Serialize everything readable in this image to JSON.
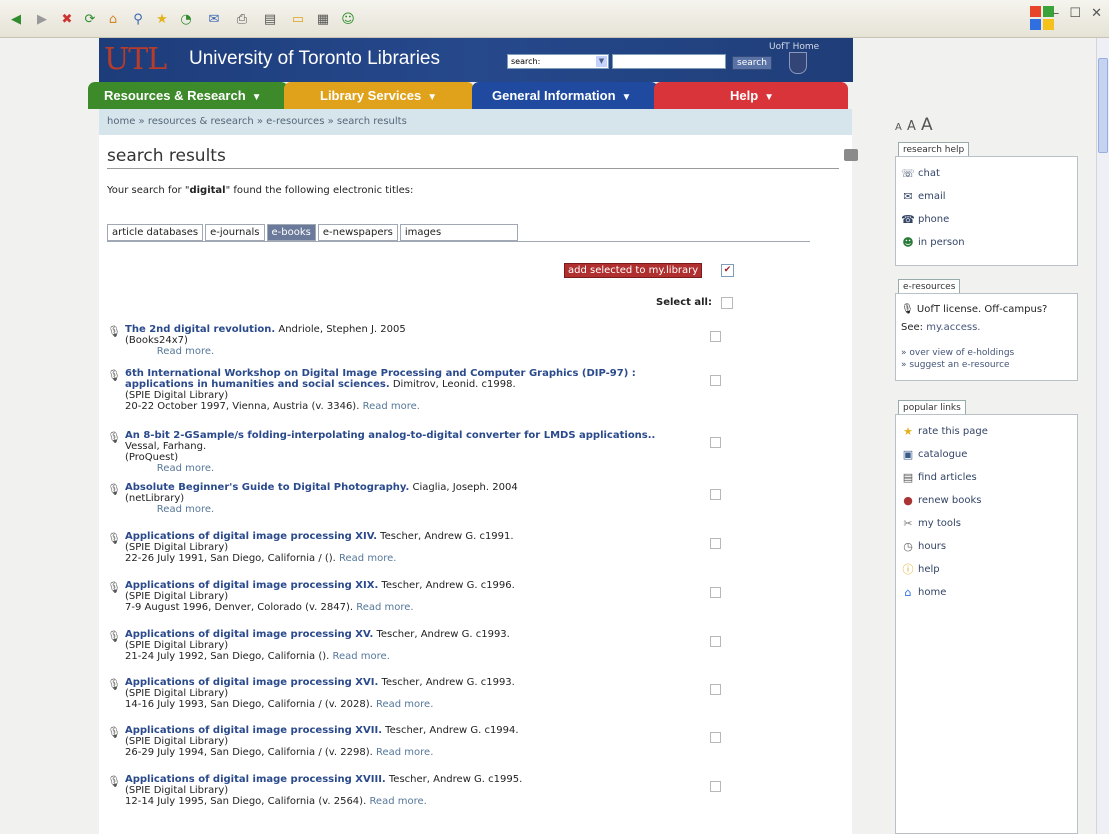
{
  "toolbar": {
    "icons": [
      "back-icon",
      "forward-icon",
      "stop-icon",
      "refresh-icon",
      "home-icon",
      "search-icon",
      "favorites-icon",
      "history-icon",
      "mail-icon",
      "print-icon",
      "edit-icon",
      "discuss-icon",
      "research-icon",
      "messenger-icon"
    ],
    "window_controls": "– ☐ ✕"
  },
  "header": {
    "logo_text": "UTL",
    "title": "University of Toronto Libraries",
    "search_label": "search:",
    "search_button": "search",
    "uoft_home": "UofT Home"
  },
  "nav": {
    "tabs": [
      {
        "label": "Resources & Research",
        "color": "#3d8a2a"
      },
      {
        "label": "Library Services",
        "color": "#e0a21a"
      },
      {
        "label": "General Information",
        "color": "#1f4aa0"
      },
      {
        "label": "Help",
        "color": "#d9343a"
      }
    ]
  },
  "breadcrumb": "home » resources & research » e-resources » search results",
  "page_title": "search results",
  "found": {
    "prefix": "Your search for \"",
    "term": "digital",
    "suffix": "\" found the following electronic titles:"
  },
  "tabs": [
    "article databases",
    "e-journals",
    "e-books",
    "e-newspapers",
    "images"
  ],
  "active_tab": "e-books",
  "add_selected": "add selected to my.library",
  "select_all": "Select all:",
  "read_more": "Read more.",
  "results": [
    {
      "title": "The 2nd digital revolution.",
      "author": " Andriole, Stephen J.    2005",
      "source": "(Books24x7)",
      "extra": ""
    },
    {
      "title": "6th International Workshop on Digital Image Processing and Computer Graphics (DIP-97) : applications in humanities and social sciences.",
      "author": " Dimitrov, Leonid.    c1998.",
      "source": "(SPIE Digital Library)",
      "extra": "20-22 October 1997, Vienna, Austria (v. 3346).   "
    },
    {
      "title": "An 8-bit 2-GSample/s folding-interpolating analog-to-digital converter for LMDS applications..",
      "author": " Vessal, Farhang.",
      "source": "(ProQuest)",
      "extra": ""
    },
    {
      "title": "Absolute Beginner's Guide to Digital Photography.",
      "author": " Ciaglia, Joseph.    2004",
      "source": "(netLibrary)",
      "extra": ""
    },
    {
      "title": "Applications of digital image processing XIV.",
      "author": " Tescher, Andrew G.    c1991.",
      "source": "(SPIE Digital Library)",
      "extra": "22-26 July 1991, San Diego, California / ().   "
    },
    {
      "title": "Applications of digital image processing XIX.",
      "author": " Tescher, Andrew G.    c1996.",
      "source": "(SPIE Digital Library)",
      "extra": "7-9 August 1996, Denver, Colorado (v. 2847).   "
    },
    {
      "title": "Applications of digital image processing XV.",
      "author": " Tescher, Andrew G.    c1993.",
      "source": "(SPIE Digital Library)",
      "extra": "21-24 July 1992, San Diego, California ().   "
    },
    {
      "title": "Applications of digital image processing XVI.",
      "author": " Tescher, Andrew G.    c1993.",
      "source": "(SPIE Digital Library)",
      "extra": "14-16 July 1993, San Diego, California / (v. 2028).   "
    },
    {
      "title": "Applications of digital image processing XVII.",
      "author": " Tescher, Andrew G.    c1994.",
      "source": "(SPIE Digital Library)",
      "extra": "26-29 July 1994, San Diego, California / (v. 2298).   "
    },
    {
      "title": "Applications of digital image processing XVIII.",
      "author": " Tescher, Andrew G.    c1995.",
      "source": "(SPIE Digital Library)",
      "extra": "12-14 July 1995, San Diego, California (v. 2564).   "
    }
  ],
  "sidebar": {
    "font_sizes": [
      "A",
      "A",
      "A"
    ],
    "research_help": {
      "heading": "research help",
      "items": [
        {
          "label": "chat",
          "icon": "chat-icon"
        },
        {
          "label": "email",
          "icon": "email-icon"
        },
        {
          "label": "phone",
          "icon": "phone-icon"
        },
        {
          "label": "in person",
          "icon": "person-icon"
        }
      ]
    },
    "eresources": {
      "heading": "e-resources",
      "license": "UofT license. Off-campus?",
      "see": "See: ",
      "see_link": "my.access.",
      "links": [
        "» over view of e-holdings",
        "» suggest an e-resource"
      ]
    },
    "popular": {
      "heading": "popular links",
      "items": [
        {
          "label": "rate this page",
          "icon": "star-icon"
        },
        {
          "label": "catalogue",
          "icon": "catalogue-icon"
        },
        {
          "label": "find articles",
          "icon": "articles-icon"
        },
        {
          "label": "renew books",
          "icon": "renew-icon"
        },
        {
          "label": "my tools",
          "icon": "tools-icon"
        },
        {
          "label": "hours",
          "icon": "clock-icon"
        },
        {
          "label": "help",
          "icon": "help-icon"
        },
        {
          "label": "home",
          "icon": "home-icon"
        }
      ]
    }
  }
}
